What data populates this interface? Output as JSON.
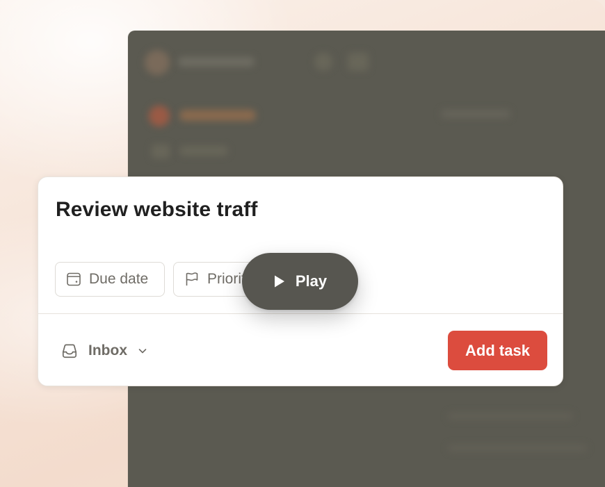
{
  "task_composer": {
    "task_name": "Review website traff",
    "chips": {
      "due_date_label": "Due date",
      "priority_label": "Priority"
    },
    "project": {
      "label": "Inbox"
    },
    "submit_label": "Add task"
  },
  "video_overlay": {
    "play_label": "Play"
  },
  "colors": {
    "accent": "#dc4c3e",
    "overlay_button": "#575650",
    "background_window": "#5b5a51"
  },
  "icons": {
    "due_date": "calendar-icon",
    "priority": "flag-icon",
    "project": "inbox-icon",
    "dropdown": "chevron-down-icon",
    "play": "play-icon"
  }
}
